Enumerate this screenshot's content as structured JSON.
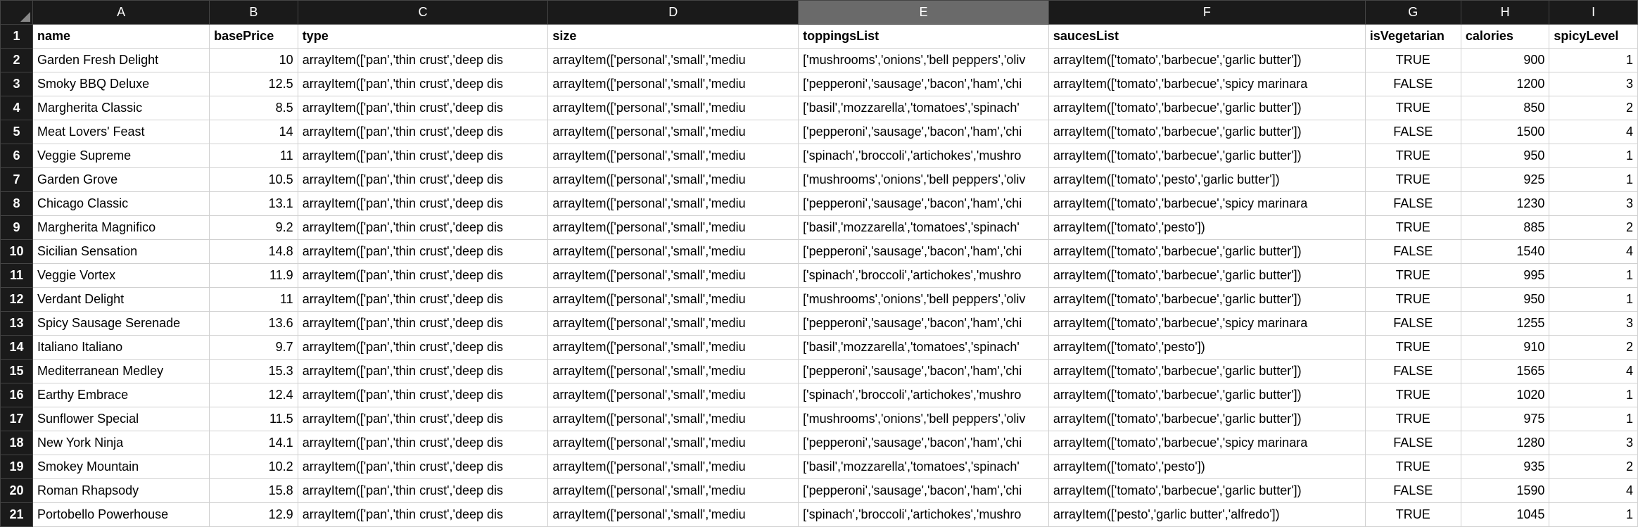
{
  "columns": [
    "A",
    "B",
    "C",
    "D",
    "E",
    "F",
    "G",
    "H",
    "I"
  ],
  "selectedColumn": "E",
  "headerRow": [
    "name",
    "basePrice",
    "type",
    "size",
    "toppingsList",
    "saucesList",
    "isVegetarian",
    "calories",
    "spicyLevel"
  ],
  "formulaC": "arrayItem(['pan','thin crust','deep dis",
  "formulaD": "arrayItem(['personal','small','mediu",
  "toppingsA": "['mushrooms','onions','bell peppers','oliv",
  "toppingsB": "['pepperoni','sausage','bacon','ham','chi",
  "toppingsC": "['basil','mozzarella','tomatoes','spinach'",
  "toppingsD": "['spinach','broccoli','artichokes','mushro",
  "saucesA": "arrayItem(['tomato','barbecue','garlic butter'])",
  "saucesB": "arrayItem(['tomato','barbecue','spicy marinara",
  "saucesC": "arrayItem(['tomato','pesto','garlic butter'])",
  "saucesD": "arrayItem(['tomato','pesto'])",
  "saucesE": "arrayItem(['pesto','garlic butter','alfredo'])",
  "rows": [
    {
      "n": "2",
      "name": "Garden Fresh Delight",
      "price": "10",
      "top": "A",
      "sauce": "A",
      "veg": "TRUE",
      "cal": "900",
      "spicy": "1"
    },
    {
      "n": "3",
      "name": "Smoky BBQ Deluxe",
      "price": "12.5",
      "top": "B",
      "sauce": "B",
      "veg": "FALSE",
      "cal": "1200",
      "spicy": "3"
    },
    {
      "n": "4",
      "name": "Margherita Classic",
      "price": "8.5",
      "top": "C",
      "sauce": "A",
      "veg": "TRUE",
      "cal": "850",
      "spicy": "2"
    },
    {
      "n": "5",
      "name": "Meat Lovers' Feast",
      "price": "14",
      "top": "B",
      "sauce": "A",
      "veg": "FALSE",
      "cal": "1500",
      "spicy": "4"
    },
    {
      "n": "6",
      "name": "Veggie Supreme",
      "price": "11",
      "top": "D",
      "sauce": "A",
      "veg": "TRUE",
      "cal": "950",
      "spicy": "1"
    },
    {
      "n": "7",
      "name": "Garden Grove",
      "price": "10.5",
      "top": "A",
      "sauce": "C",
      "veg": "TRUE",
      "cal": "925",
      "spicy": "1"
    },
    {
      "n": "8",
      "name": "Chicago Classic",
      "price": "13.1",
      "top": "B",
      "sauce": "B",
      "veg": "FALSE",
      "cal": "1230",
      "spicy": "3"
    },
    {
      "n": "9",
      "name": "Margherita Magnifico",
      "price": "9.2",
      "top": "C",
      "sauce": "D",
      "veg": "TRUE",
      "cal": "885",
      "spicy": "2"
    },
    {
      "n": "10",
      "name": "Sicilian Sensation",
      "price": "14.8",
      "top": "B",
      "sauce": "A",
      "veg": "FALSE",
      "cal": "1540",
      "spicy": "4"
    },
    {
      "n": "11",
      "name": "Veggie Vortex",
      "price": "11.9",
      "top": "D",
      "sauce": "A",
      "veg": "TRUE",
      "cal": "995",
      "spicy": "1"
    },
    {
      "n": "12",
      "name": "Verdant Delight",
      "price": "11",
      "top": "A",
      "sauce": "A",
      "veg": "TRUE",
      "cal": "950",
      "spicy": "1"
    },
    {
      "n": "13",
      "name": "Spicy Sausage Serenade",
      "price": "13.6",
      "top": "B",
      "sauce": "B",
      "veg": "FALSE",
      "cal": "1255",
      "spicy": "3"
    },
    {
      "n": "14",
      "name": "Italiano Italiano",
      "price": "9.7",
      "top": "C",
      "sauce": "D",
      "veg": "TRUE",
      "cal": "910",
      "spicy": "2"
    },
    {
      "n": "15",
      "name": "Mediterranean Medley",
      "price": "15.3",
      "top": "B",
      "sauce": "A",
      "veg": "FALSE",
      "cal": "1565",
      "spicy": "4"
    },
    {
      "n": "16",
      "name": "Earthy Embrace",
      "price": "12.4",
      "top": "D",
      "sauce": "A",
      "veg": "TRUE",
      "cal": "1020",
      "spicy": "1"
    },
    {
      "n": "17",
      "name": "Sunflower Special",
      "price": "11.5",
      "top": "A",
      "sauce": "A",
      "veg": "TRUE",
      "cal": "975",
      "spicy": "1"
    },
    {
      "n": "18",
      "name": "New York Ninja",
      "price": "14.1",
      "top": "B",
      "sauce": "B",
      "veg": "FALSE",
      "cal": "1280",
      "spicy": "3"
    },
    {
      "n": "19",
      "name": "Smokey Mountain",
      "price": "10.2",
      "top": "C",
      "sauce": "D",
      "veg": "TRUE",
      "cal": "935",
      "spicy": "2"
    },
    {
      "n": "20",
      "name": "Roman Rhapsody",
      "price": "15.8",
      "top": "B",
      "sauce": "A",
      "veg": "FALSE",
      "cal": "1590",
      "spicy": "4"
    },
    {
      "n": "21",
      "name": "Portobello Powerhouse",
      "price": "12.9",
      "top": "D",
      "sauce": "E",
      "veg": "TRUE",
      "cal": "1045",
      "spicy": "1"
    }
  ]
}
